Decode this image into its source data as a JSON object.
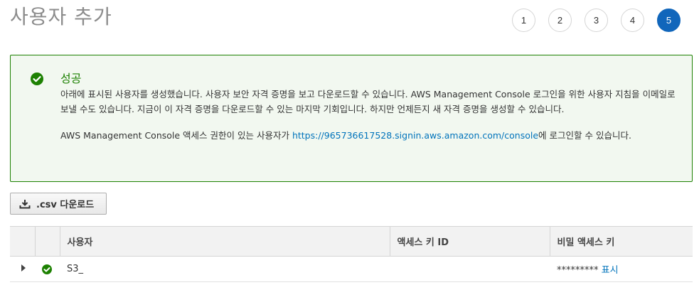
{
  "page": {
    "title": "사용자 추가"
  },
  "steps": [
    {
      "label": "1",
      "active": false
    },
    {
      "label": "2",
      "active": false
    },
    {
      "label": "3",
      "active": false
    },
    {
      "label": "4",
      "active": false
    },
    {
      "label": "5",
      "active": true
    }
  ],
  "alert": {
    "icon": "check-circle-icon",
    "title": "성공",
    "body_line1": "아래에 표시된 사용자를 생성했습니다. 사용자 보안 자격 증명을 보고 다운로드할 수 있습니다. AWS Management Console 로그인을 위한 사용자 지침을 이메일로 보낼 수도 있습니다. 지금이 이 자격 증명을 다운로드할 수 있는 마지막 기회입니다. 하지만 언제든지 새 자격 증명을 생성할 수 있습니다.",
    "body_prefix": "AWS Management Console 액세스 권한이 있는 사용자가 ",
    "console_link": "https://965736617528.signin.aws.amazon.com/console",
    "body_suffix": "에 로그인할 수 있습니다.",
    "color": "#1d8102",
    "background": "#f2f8f0"
  },
  "toolbar": {
    "csv_button_label": ".csv 다운로드",
    "csv_icon": "download-icon"
  },
  "table": {
    "headers": {
      "user": "사용자",
      "access_key_id": "액세스 키 ID",
      "secret_access_key": "비밀 액세스 키"
    },
    "rows": [
      {
        "user": "S3_",
        "access_key_id": "",
        "secret_masked": "*********",
        "show_link": "표시",
        "status_icon": "check-circle-icon"
      }
    ]
  },
  "colors": {
    "accent_blue": "#1166bb",
    "link": "#0073bb",
    "success": "#1d8102"
  }
}
